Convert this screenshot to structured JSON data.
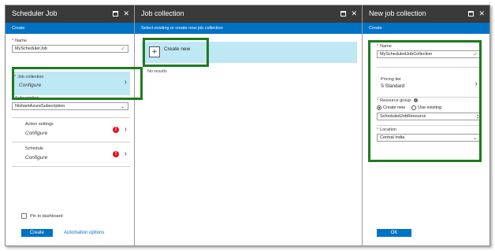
{
  "blade1": {
    "title": "Scheduler Job",
    "cmd": "Create",
    "name_label": "Name",
    "name_value": "MySchedulerJob",
    "jobcoll_label": "Job collection",
    "jobcoll_value": "Configure",
    "subscription_label": "Subscription",
    "subscription_value": "NishantAzureSubscription",
    "action_label": "Action settings",
    "action_value": "Configure",
    "schedule_label": "Schedule",
    "schedule_value": "Configure",
    "pin_label": "Pin to dashboard",
    "create_btn": "Create",
    "automation_link": "Automation options"
  },
  "blade2": {
    "title": "Job collection",
    "cmd": "Select existing or create new job collection",
    "create_new": "Create new",
    "no_results": "No results"
  },
  "blade3": {
    "title": "New job collection",
    "cmd": "Create",
    "name_label": "Name",
    "name_value": "MyScheduledJobCollection",
    "pricing_label": "Pricing tier",
    "pricing_value": "S Standard",
    "rg_label": "Resource group",
    "rg_create": "Create new",
    "rg_existing": "Use existing",
    "rg_value": "ScheduledJobResource",
    "location_label": "Location",
    "location_value": "Central India",
    "ok_btn": "OK"
  },
  "colors": {
    "accent": "#0072c6",
    "header": "#3a3a3a",
    "highlight": "#bfe8f5",
    "green": "#1e7a1e",
    "warn": "#e81123"
  }
}
